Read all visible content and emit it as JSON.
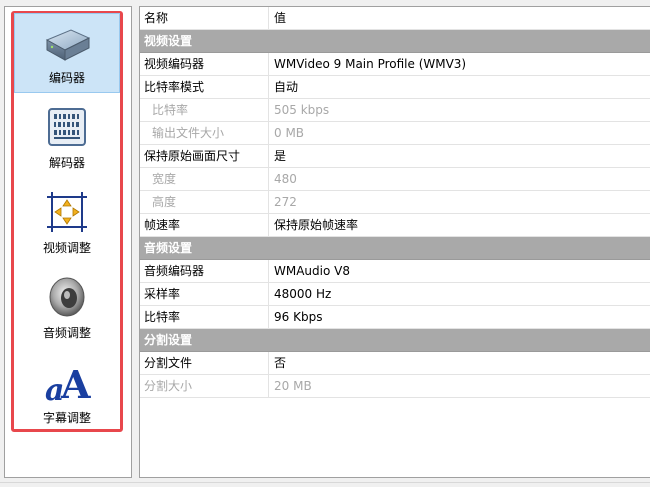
{
  "sidebar": {
    "items": [
      {
        "label": "编码器",
        "icon": "encoder-device-icon",
        "selected": true
      },
      {
        "label": "解码器",
        "icon": "decoder-barcode-icon",
        "selected": false
      },
      {
        "label": "视频调整",
        "icon": "video-resize-arrows-icon",
        "selected": false
      },
      {
        "label": "音频调整",
        "icon": "speaker-icon",
        "selected": false
      },
      {
        "label": "字幕调整",
        "icon": "subtitle-letter-a-icon",
        "selected": false
      }
    ],
    "highlight_color": "#e8474c",
    "selected_bg": "#cce4f7"
  },
  "grid": {
    "header": {
      "name": "名称",
      "value": "值"
    },
    "rows": [
      {
        "type": "category",
        "name": "视频设置"
      },
      {
        "type": "prop",
        "name": "视频编码器",
        "value": "WMVideo 9 Main Profile (WMV3)"
      },
      {
        "type": "prop",
        "name": "比特率模式",
        "value": "自动"
      },
      {
        "type": "prop",
        "name": "比特率",
        "value": "505 kbps",
        "sub": true,
        "disabled": true
      },
      {
        "type": "prop",
        "name": "输出文件大小",
        "value": "0 MB",
        "sub": true,
        "disabled": true
      },
      {
        "type": "prop",
        "name": "保持原始画面尺寸",
        "value": "是"
      },
      {
        "type": "prop",
        "name": "宽度",
        "value": "480",
        "sub": true,
        "disabled": true
      },
      {
        "type": "prop",
        "name": "高度",
        "value": "272",
        "sub": true,
        "disabled": true
      },
      {
        "type": "prop",
        "name": "帧速率",
        "value": "保持原始帧速率"
      },
      {
        "type": "category",
        "name": "音频设置"
      },
      {
        "type": "prop",
        "name": "音频编码器",
        "value": "WMAudio V8"
      },
      {
        "type": "prop",
        "name": "采样率",
        "value": "48000 Hz"
      },
      {
        "type": "prop",
        "name": "比特率",
        "value": "96 Kbps"
      },
      {
        "type": "category",
        "name": "分割设置"
      },
      {
        "type": "prop",
        "name": "分割文件",
        "value": "否"
      },
      {
        "type": "prop",
        "name": "分割大小",
        "value": "20 MB",
        "disabled": true
      }
    ],
    "category_bg": "#a9a9a9",
    "disabled_color": "#a8a8a8"
  }
}
